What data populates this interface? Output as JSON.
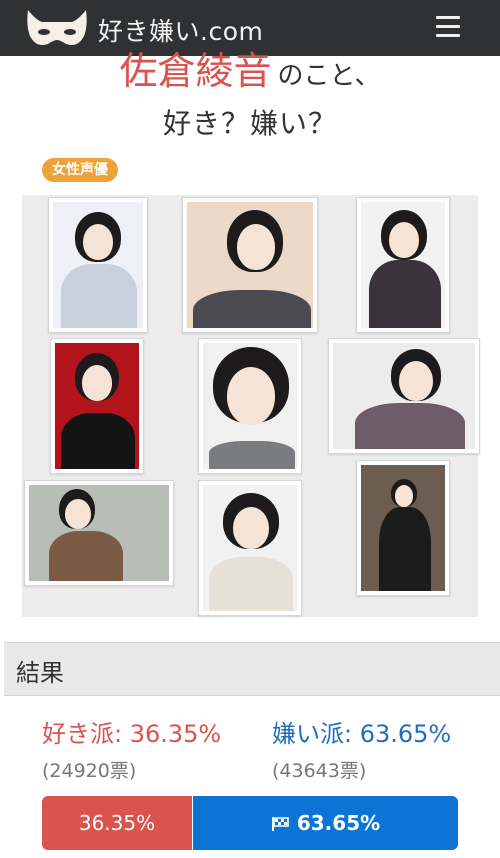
{
  "header": {
    "site_name": "好き嫌い.com",
    "menu_icon": "hamburger-icon",
    "logo_icon": "mask-logo-icon"
  },
  "title": {
    "name": "佐倉綾音",
    "suffix": "のこと、",
    "question": "好き？嫌い？"
  },
  "tag": "女性声優",
  "gallery": {
    "photo_count": 9
  },
  "results": {
    "heading": "結果",
    "like_label": "好き派",
    "like_pct": "36.35%",
    "like_votes": "(24920票)",
    "dislike_label": "嫌い派",
    "dislike_pct": "63.65%",
    "dislike_votes": "(43643票)",
    "bar_like_text": "36.35%",
    "bar_dislike_text": "63.65%",
    "like_fraction": 0.3635,
    "dislike_fraction": 0.6365,
    "winner_icon": "flag-icon"
  },
  "colors": {
    "header_bg": "#2f3133",
    "like": "#d9534f",
    "dislike": "#0b74d4",
    "tag": "#eda23a"
  }
}
